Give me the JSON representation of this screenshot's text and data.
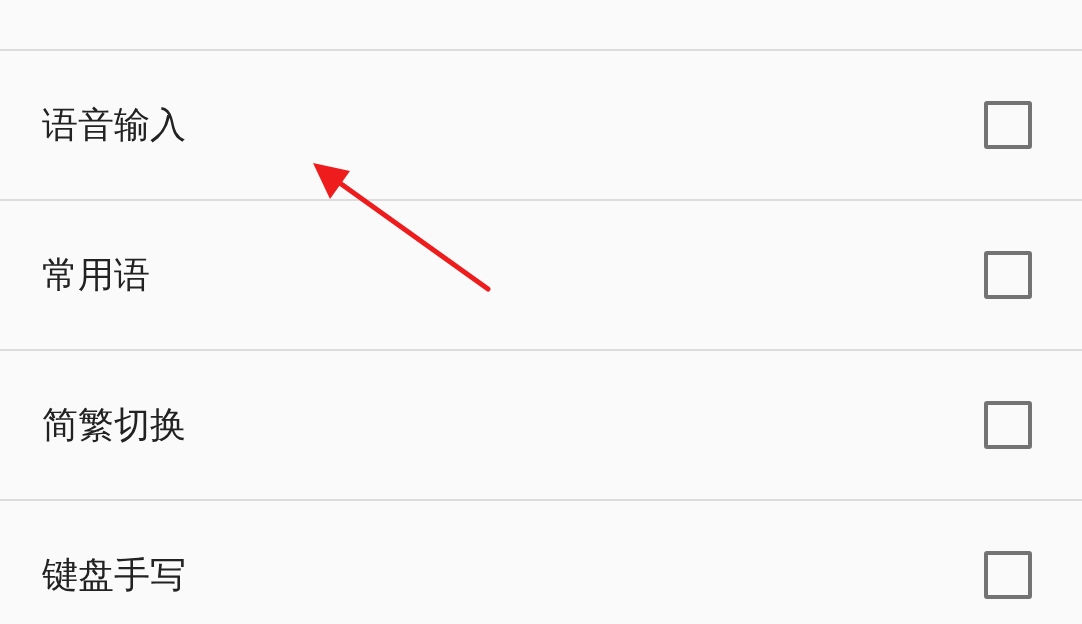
{
  "settings_list": [
    {
      "label": "语音输入",
      "checked": false
    },
    {
      "label": "常用语",
      "checked": false
    },
    {
      "label": "简繁切换",
      "checked": false
    },
    {
      "label": "键盘手写",
      "checked": false
    }
  ]
}
